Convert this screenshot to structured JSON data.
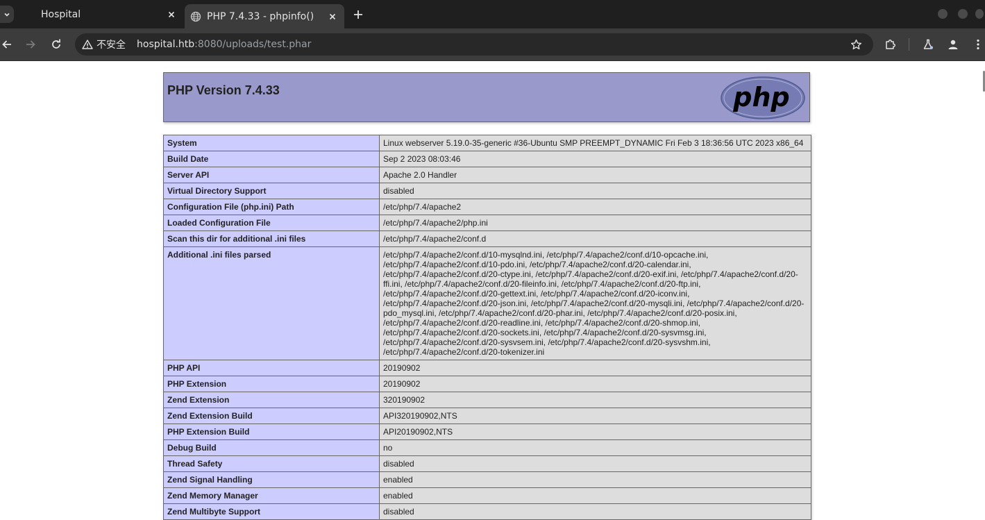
{
  "browser": {
    "tabs": [
      {
        "title": "Hospital",
        "active": false
      },
      {
        "title": "PHP 7.4.33 - phpinfo()",
        "active": true
      }
    ],
    "security_label": "不安全",
    "url_host": "hospital.htb",
    "url_rest": ":8080/uploads/test.phar"
  },
  "phpinfo": {
    "version_title": "PHP Version 7.4.33",
    "logo_text": "php",
    "rows": [
      {
        "key": "System",
        "value": "Linux webserver 5.19.0-35-generic #36-Ubuntu SMP PREEMPT_DYNAMIC Fri Feb 3 18:36:56 UTC 2023 x86_64"
      },
      {
        "key": "Build Date",
        "value": "Sep 2 2023 08:03:46"
      },
      {
        "key": "Server API",
        "value": "Apache 2.0 Handler"
      },
      {
        "key": "Virtual Directory Support",
        "value": "disabled"
      },
      {
        "key": "Configuration File (php.ini) Path",
        "value": "/etc/php/7.4/apache2"
      },
      {
        "key": "Loaded Configuration File",
        "value": "/etc/php/7.4/apache2/php.ini"
      },
      {
        "key": "Scan this dir for additional .ini files",
        "value": "/etc/php/7.4/apache2/conf.d"
      },
      {
        "key": "Additional .ini files parsed",
        "value": "/etc/php/7.4/apache2/conf.d/10-mysqlnd.ini, /etc/php/7.4/apache2/conf.d/10-opcache.ini, /etc/php/7.4/apache2/conf.d/10-pdo.ini, /etc/php/7.4/apache2/conf.d/20-calendar.ini, /etc/php/7.4/apache2/conf.d/20-ctype.ini, /etc/php/7.4/apache2/conf.d/20-exif.ini, /etc/php/7.4/apache2/conf.d/20-ffi.ini, /etc/php/7.4/apache2/conf.d/20-fileinfo.ini, /etc/php/7.4/apache2/conf.d/20-ftp.ini, /etc/php/7.4/apache2/conf.d/20-gettext.ini, /etc/php/7.4/apache2/conf.d/20-iconv.ini, /etc/php/7.4/apache2/conf.d/20-json.ini, /etc/php/7.4/apache2/conf.d/20-mysqli.ini, /etc/php/7.4/apache2/conf.d/20-pdo_mysql.ini, /etc/php/7.4/apache2/conf.d/20-phar.ini, /etc/php/7.4/apache2/conf.d/20-posix.ini, /etc/php/7.4/apache2/conf.d/20-readline.ini, /etc/php/7.4/apache2/conf.d/20-shmop.ini, /etc/php/7.4/apache2/conf.d/20-sockets.ini, /etc/php/7.4/apache2/conf.d/20-sysvmsg.ini, /etc/php/7.4/apache2/conf.d/20-sysvsem.ini, /etc/php/7.4/apache2/conf.d/20-sysvshm.ini, /etc/php/7.4/apache2/conf.d/20-tokenizer.ini"
      },
      {
        "key": "PHP API",
        "value": "20190902"
      },
      {
        "key": "PHP Extension",
        "value": "20190902"
      },
      {
        "key": "Zend Extension",
        "value": "320190902"
      },
      {
        "key": "Zend Extension Build",
        "value": "API320190902,NTS"
      },
      {
        "key": "PHP Extension Build",
        "value": "API20190902,NTS"
      },
      {
        "key": "Debug Build",
        "value": "no"
      },
      {
        "key": "Thread Safety",
        "value": "disabled"
      },
      {
        "key": "Zend Signal Handling",
        "value": "enabled"
      },
      {
        "key": "Zend Memory Manager",
        "value": "enabled"
      },
      {
        "key": "Zend Multibyte Support",
        "value": "disabled"
      }
    ]
  },
  "colors": {
    "header_bg": "#9999cc",
    "key_bg": "#ccccff",
    "value_bg": "#dddddd",
    "chrome_dark": "#1f1f1f",
    "chrome_toolbar": "#3c3c3c"
  },
  "icons": {
    "back": "arrow-left-icon",
    "forward": "arrow-right-icon",
    "reload": "reload-icon",
    "warning": "warning-triangle-icon",
    "bookmark": "star-icon",
    "extensions": "puzzle-icon",
    "labs": "flask-icon",
    "profile": "person-icon",
    "menu": "kebab-menu-icon"
  }
}
